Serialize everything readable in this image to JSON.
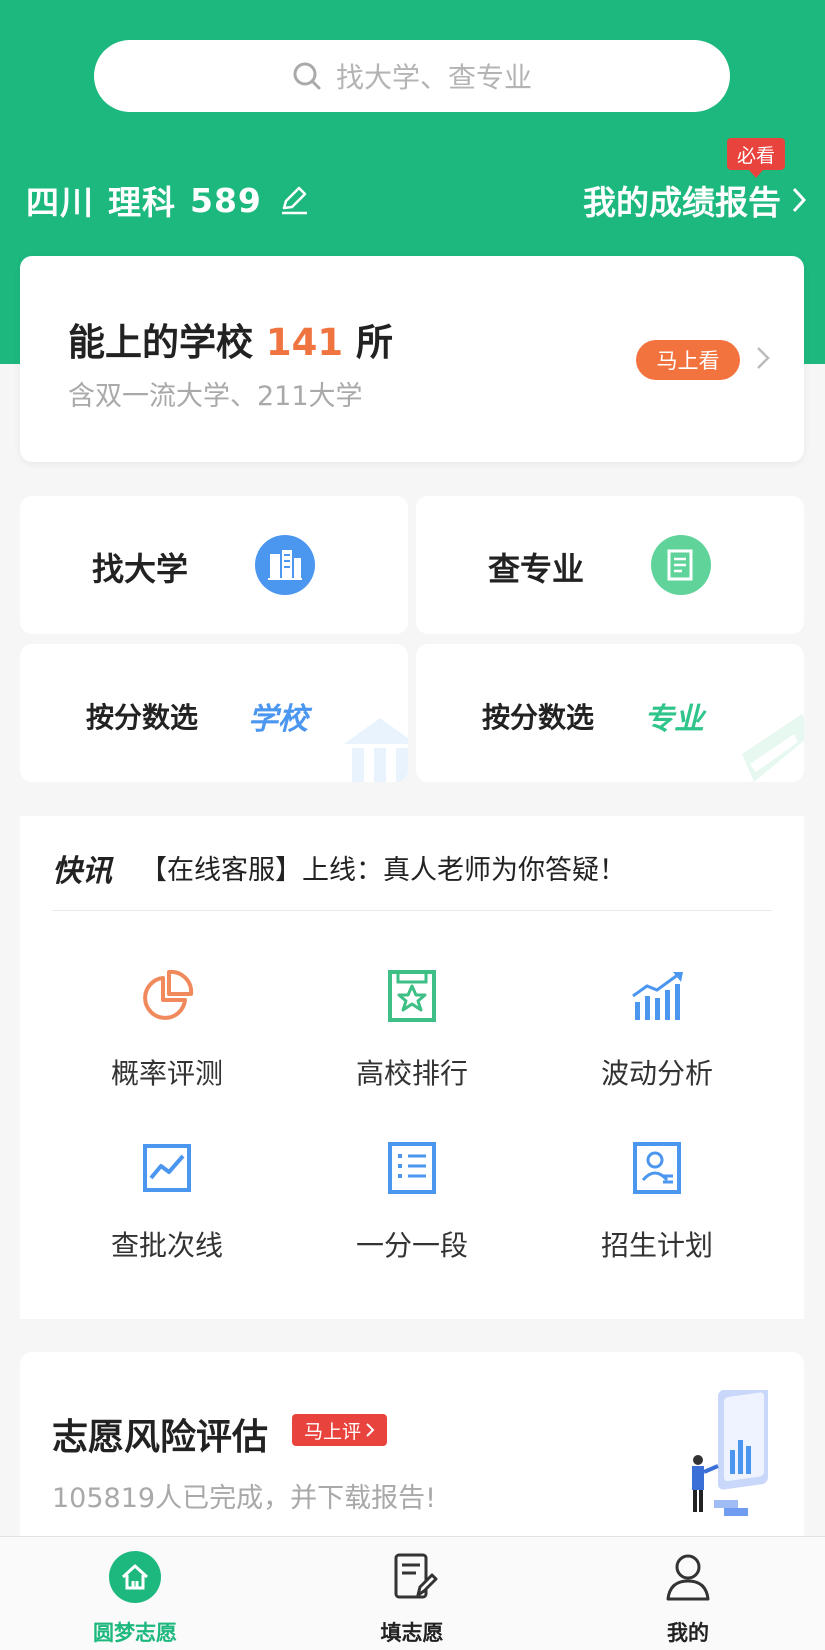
{
  "search": {
    "placeholder": "找大学、查专业"
  },
  "profile": {
    "province": "四川",
    "subject": "理科",
    "score": "589"
  },
  "report": {
    "label": "我的成绩报告",
    "badge": "必看"
  },
  "main_card": {
    "title_prefix": "能上的学校",
    "count": "141",
    "title_suffix": "所",
    "subtitle": "含双一流大学、211大学",
    "button": "马上看"
  },
  "tiles": {
    "find_university": "找大学",
    "find_major": "查专业",
    "score_school_prefix": "按分数选",
    "score_school_tag": "学校",
    "score_major_prefix": "按分数选",
    "score_major_tag": "专业"
  },
  "news": {
    "logo": "快讯",
    "text": "【在线客服】上线：真人老师为你答疑！"
  },
  "tools": [
    {
      "label": "概率评测",
      "icon": "pie-chart-icon"
    },
    {
      "label": "高校排行",
      "icon": "ranking-star-icon"
    },
    {
      "label": "波动分析",
      "icon": "bar-trend-icon"
    },
    {
      "label": "查批次线",
      "icon": "line-chart-icon"
    },
    {
      "label": "一分一段",
      "icon": "list-document-icon"
    },
    {
      "label": "招生计划",
      "icon": "person-card-icon"
    }
  ],
  "risk": {
    "title": "志愿风险评估",
    "badge": "马上评",
    "subtitle": "105819人已完成，并下载报告!"
  },
  "tabbar": [
    {
      "label": "圆梦志愿",
      "active": true
    },
    {
      "label": "填志愿",
      "active": false
    },
    {
      "label": "我的",
      "active": false
    }
  ],
  "colors": {
    "brand_green": "#1db87e",
    "accent_orange": "#f3733f",
    "badge_red": "#e8443d"
  }
}
